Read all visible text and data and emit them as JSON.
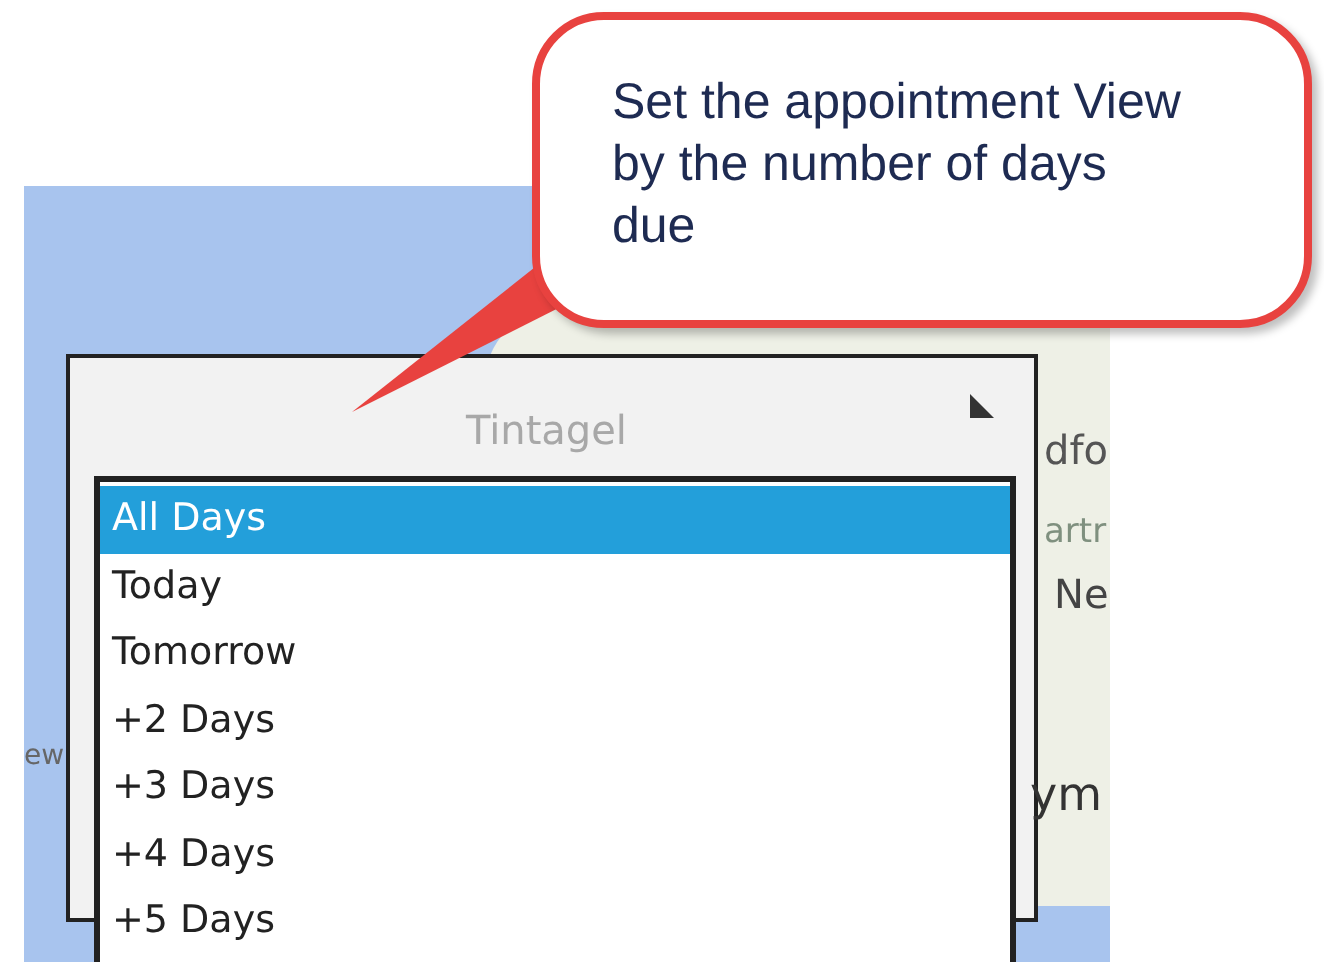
{
  "callout": {
    "text": "Set the appointment View by the number of days due"
  },
  "map": {
    "labels": [
      {
        "text": "Tintagel"
      },
      {
        "text": "dfo"
      },
      {
        "text": "artr"
      },
      {
        "text": "Ne"
      },
      {
        "text": "ew"
      },
      {
        "text": "ym"
      }
    ]
  },
  "day_list": {
    "items": [
      {
        "label": "All Days",
        "selected": true
      },
      {
        "label": "Today",
        "selected": false
      },
      {
        "label": "Tomorrow",
        "selected": false
      },
      {
        "label": "+2 Days",
        "selected": false
      },
      {
        "label": "+3 Days",
        "selected": false
      },
      {
        "label": "+4 Days",
        "selected": false
      },
      {
        "label": "+5 Days",
        "selected": false
      }
    ]
  }
}
